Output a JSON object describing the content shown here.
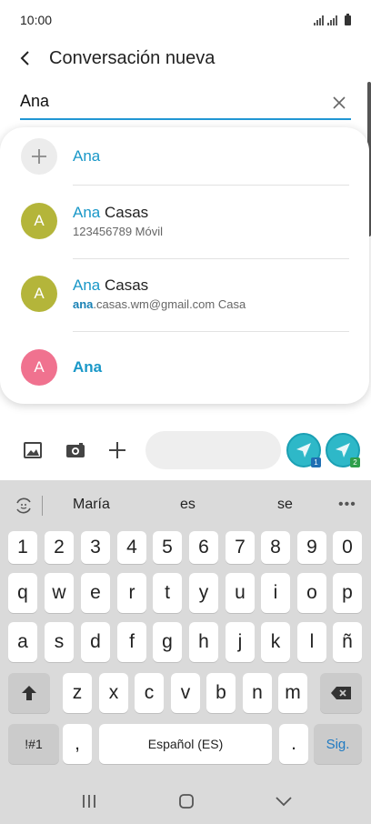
{
  "status_bar": {
    "time": "10:00"
  },
  "header": {
    "title": "Conversación nueva"
  },
  "recipient": {
    "value": "Ana"
  },
  "suggestions": [
    {
      "name_match": "Ana",
      "name_rest": "",
      "sub_match": "",
      "sub_rest": "",
      "avatar_letter": ""
    },
    {
      "name_match": "Ana",
      "name_rest": " Casas",
      "sub_match": "",
      "sub_rest": "123456789  Móvil",
      "avatar_letter": "A"
    },
    {
      "name_match": "Ana",
      "name_rest": " Casas",
      "sub_match": "ana",
      "sub_rest": ".casas.wm@gmail.com  Casa",
      "avatar_letter": "A"
    },
    {
      "name_match": "Ana",
      "name_rest": "",
      "sub_match": "",
      "sub_rest": "",
      "avatar_letter": "A"
    }
  ],
  "compose": {
    "sim1_badge": "1",
    "sim2_badge": "2"
  },
  "keyboard": {
    "predictions": [
      "María",
      "es",
      "se"
    ],
    "more": "•••",
    "row_numbers": [
      "1",
      "2",
      "3",
      "4",
      "5",
      "6",
      "7",
      "8",
      "9",
      "0"
    ],
    "row_q": [
      "q",
      "w",
      "e",
      "r",
      "t",
      "y",
      "u",
      "i",
      "o",
      "p"
    ],
    "row_a": [
      "a",
      "s",
      "d",
      "f",
      "g",
      "h",
      "j",
      "k",
      "l",
      "ñ"
    ],
    "row_z": [
      "z",
      "x",
      "c",
      "v",
      "b",
      "n",
      "m"
    ],
    "symbols_label": "!#1",
    "comma_label": ",",
    "space_label": "Español (ES)",
    "period_label": ".",
    "next_label": "Sig."
  },
  "colors": {
    "accent": "#1a98c8",
    "avatar_olive": "#b4b53a",
    "avatar_pink": "#f0728f",
    "send": "#2eb8c8",
    "sim1": "#1f6fb3",
    "sim2": "#2e9e4a"
  }
}
